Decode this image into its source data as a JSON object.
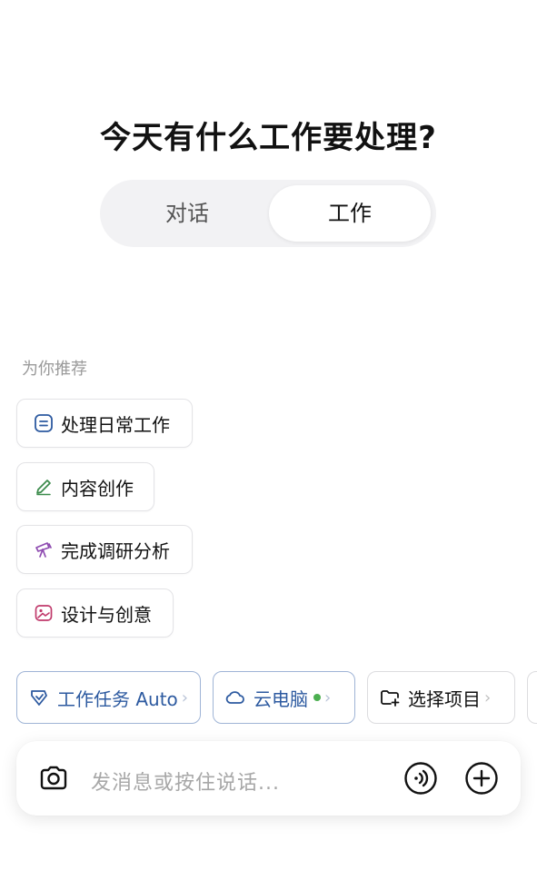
{
  "header": {
    "title": "今天有什么工作要处理?"
  },
  "mode_toggle": {
    "tabs": [
      {
        "label": "对话",
        "selected": false
      },
      {
        "label": "工作",
        "selected": true
      }
    ]
  },
  "recommend": {
    "label": "为你推荐",
    "items": [
      {
        "label": "处理日常工作",
        "icon": "list-icon",
        "color": "#2d5aa0"
      },
      {
        "label": "内容创作",
        "icon": "pen-icon",
        "color": "#3a8a4a"
      },
      {
        "label": "完成调研分析",
        "icon": "telescope-icon",
        "color": "#8e4bb0"
      },
      {
        "label": "设计与创意",
        "icon": "image-icon",
        "color": "#c0396b"
      }
    ]
  },
  "toolbar": {
    "task": {
      "label": "工作任务 Auto",
      "chevron": "›"
    },
    "cloud": {
      "label": "云电脑",
      "chevron": "›",
      "status_color": "#4caf50"
    },
    "project": {
      "label": "选择项目",
      "chevron": "›"
    }
  },
  "composer": {
    "placeholder": "发消息或按住说话..."
  },
  "colors": {
    "accent_blue": "#2d5aa0",
    "accent_border": "#9fb4d6"
  }
}
